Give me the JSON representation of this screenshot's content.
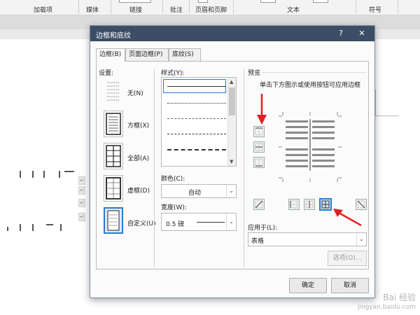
{
  "ribbon": {
    "groups": [
      "加载项",
      "媒体",
      "链接",
      "批注",
      "页眉和页脚",
      "文本",
      "符号"
    ]
  },
  "dialog": {
    "title": "边框和底纹",
    "help_label": "?",
    "close_label": "✕",
    "tabs": [
      "边框(B)",
      "页面边框(P)",
      "底纹(S)"
    ],
    "settings_label": "设置:",
    "settings": [
      "无(N)",
      "方框(X)",
      "全部(A)",
      "虚框(D)",
      "自定义(U)"
    ],
    "style_label": "样式(Y):",
    "color_label": "颜色(C):",
    "color_value": "自动",
    "width_label": "宽度(W):",
    "width_value": "0.5 磅",
    "preview_label": "预览",
    "preview_hint": "单击下方图示或使用按钮可应用边框",
    "apply_label": "应用于(L):",
    "apply_value": "表格",
    "options_button": "选项(O)...",
    "ok_button": "确定",
    "cancel_button": "取消"
  },
  "watermark": {
    "line1": "Bai 经验",
    "line2": "jingyan.baidu.com"
  },
  "colors": {
    "accent": "#2b7bd2",
    "titlebar": "#3c4d66",
    "annotation_arrow": "#e02020"
  }
}
